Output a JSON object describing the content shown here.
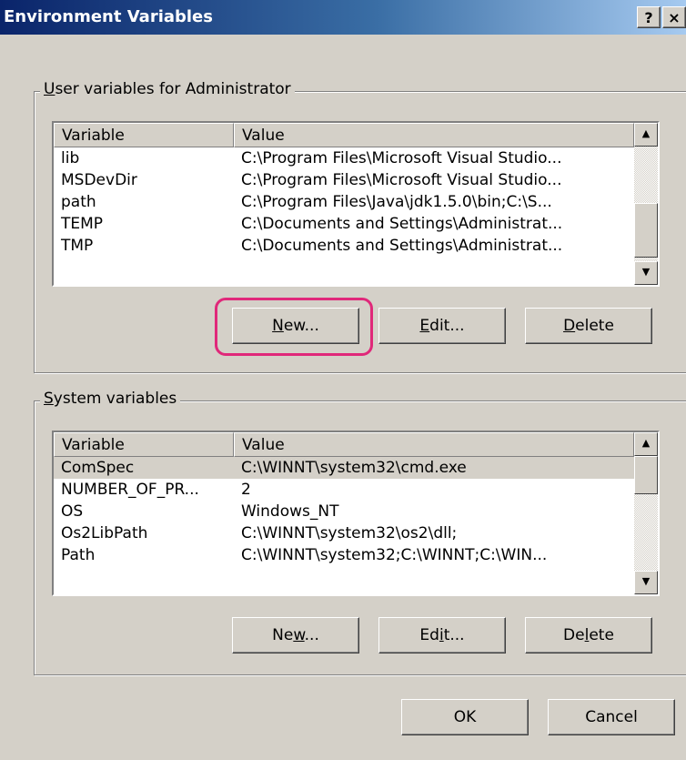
{
  "window": {
    "title": "Environment Variables",
    "help_label": "?",
    "close_label": "×"
  },
  "user_group": {
    "label_prefix": "",
    "label_mnemonic": "U",
    "label_rest": "ser variables for Administrator",
    "columns": [
      "Variable",
      "Value"
    ],
    "rows": [
      {
        "variable": "lib",
        "value": "C:\\Program Files\\Microsoft Visual Studio..."
      },
      {
        "variable": "MSDevDir",
        "value": "C:\\Program Files\\Microsoft Visual Studio..."
      },
      {
        "variable": "path",
        "value": "C:\\Program Files\\Java\\jdk1.5.0\\bin;C:\\S..."
      },
      {
        "variable": "TEMP",
        "value": "C:\\Documents and Settings\\Administrat..."
      },
      {
        "variable": "TMP",
        "value": "C:\\Documents and Settings\\Administrat..."
      }
    ],
    "buttons": {
      "new": {
        "pre": "",
        "mn": "N",
        "post": "ew..."
      },
      "edit": {
        "pre": "",
        "mn": "E",
        "post": "dit..."
      },
      "delete": {
        "pre": "",
        "mn": "D",
        "post": "elete"
      }
    }
  },
  "system_group": {
    "label_prefix": "",
    "label_mnemonic": "S",
    "label_rest": "ystem variables",
    "columns": [
      "Variable",
      "Value"
    ],
    "rows": [
      {
        "variable": "ComSpec",
        "value": "C:\\WINNT\\system32\\cmd.exe",
        "selected": true
      },
      {
        "variable": "NUMBER_OF_PR...",
        "value": "2"
      },
      {
        "variable": "OS",
        "value": "Windows_NT"
      },
      {
        "variable": "Os2LibPath",
        "value": "C:\\WINNT\\system32\\os2\\dll;"
      },
      {
        "variable": "Path",
        "value": "C:\\WINNT\\system32;C:\\WINNT;C:\\WIN..."
      }
    ],
    "buttons": {
      "new": {
        "pre": "Ne",
        "mn": "w",
        "post": "..."
      },
      "edit": {
        "pre": "Ed",
        "mn": "i",
        "post": "t..."
      },
      "delete": {
        "pre": "De",
        "mn": "l",
        "post": "ete"
      }
    }
  },
  "footer": {
    "ok_label": "OK",
    "cancel_label": "Cancel"
  },
  "colors": {
    "highlight": "#e0287a",
    "titlebar_start": "#0a246a",
    "titlebar_end": "#a6caf0"
  }
}
